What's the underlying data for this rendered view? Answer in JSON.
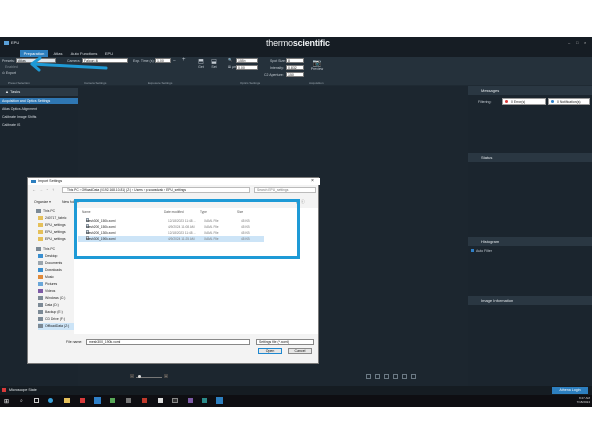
{
  "app": {
    "title": "EPU",
    "brand_light": "thermo",
    "brand_bold": "scientific"
  },
  "tabs": [
    {
      "label": "Preparation"
    },
    {
      "label": "Atlas"
    },
    {
      "label": "Auto Functions"
    },
    {
      "label": "EPU"
    }
  ],
  "toolbar": {
    "presets_label": "Presets:",
    "preset_value": "Atlas",
    "camera_label": "Camera:",
    "camera_value": "Falcon 4i",
    "exp_label": "Exp. Time (s):",
    "exp_value": "1.00",
    "mag_value": "155×",
    "spot_label": "Spot Size:",
    "spot_value": "8",
    "intensity_label": "Intensity:",
    "intensity_value": "0.832",
    "aperture_label": "C2 Aperture:",
    "aperture_value": "150",
    "defocus_value": "0.00",
    "get_label": "Get",
    "set_label": "Set",
    "preview_label": "Preview",
    "row2_item": "Enabled",
    "export_label": "Export",
    "sections": [
      "Preset Selection",
      "Camera Settings",
      "Exposure Settings",
      "Optics Settings",
      "Acquisition"
    ]
  },
  "tasks": {
    "title": "Tasks",
    "items": [
      "Acquisition and Optics Settings",
      "Atlas Optics Alignment",
      "Calibrate Image Shifts",
      "Calibrate IS"
    ],
    "selected_index": 0
  },
  "right_panel": {
    "messages_title": "Messages",
    "filtering_label": "Filtering:",
    "errors_badge": "0 Error(s)",
    "notifications_badge": "0 Notification(s)",
    "status_title": "Status",
    "histogram_title": "Histogram",
    "auto_filter_label": "Auto Filter",
    "image_info_title": "Image Information"
  },
  "statusbar": {
    "microscope_state": "Microscope State",
    "login": "Athena Login"
  },
  "taskbar": {
    "time": "8:27 AM",
    "date": "7/18/2024"
  },
  "dialog": {
    "title": "Import Settings",
    "breadcrumb": "This PC  ›  OffloadData (\\\\192.168.10.81) (Z:)  ›  Users  ›  p.sowadzak  ›  EPU_settings",
    "search_placeholder": "Search EPU_settings",
    "organize_label": "Organize ▾",
    "new_folder_label": "New folder",
    "nav_items": [
      "This PC",
      "240717_fabric",
      "EPU_settings",
      "EPU_settings",
      "EPU_settings",
      "This PC",
      "Desktop",
      "Documents",
      "Downloads",
      "Music",
      "Pictures",
      "Videos",
      "Windows (C:)",
      "Data (D:)",
      "Backup (E:)",
      "CD Drive (F:)",
      "OffloadData (Z:)"
    ],
    "columns": [
      "Name",
      "Date modified",
      "Type",
      "Size"
    ],
    "files": [
      {
        "name": "mesh300_150k.xoml",
        "date": "12/18/2023 11:48 ...",
        "type": "XAML File",
        "size": "45 KB"
      },
      {
        "name": "mesh200_150k.xoml",
        "date": "4/9/2024 11:08 AM",
        "type": "XAML File",
        "size": "45 KB"
      },
      {
        "name": "mesh200_130k.xoml",
        "date": "12/18/2023 11:48 ...",
        "type": "XAML File",
        "size": "45 KB"
      },
      {
        "name": "mesh300_190k.xoml",
        "date": "4/9/2024 11:25 AM",
        "type": "XAML File",
        "size": "45 KB"
      }
    ],
    "selected_file": 3,
    "filename_label": "File name:",
    "filename_value": "mesh300_190k.xoml",
    "filter_value": "Settings file (*.xoml)",
    "open_label": "Open",
    "cancel_label": "Cancel"
  },
  "colors": {
    "accent": "#1e88d0",
    "highlight_box": "#1e9ad6",
    "selected_task": "#2f77b3",
    "error_badge": "#d83a3a",
    "notification_badge": "#2f80c8"
  }
}
